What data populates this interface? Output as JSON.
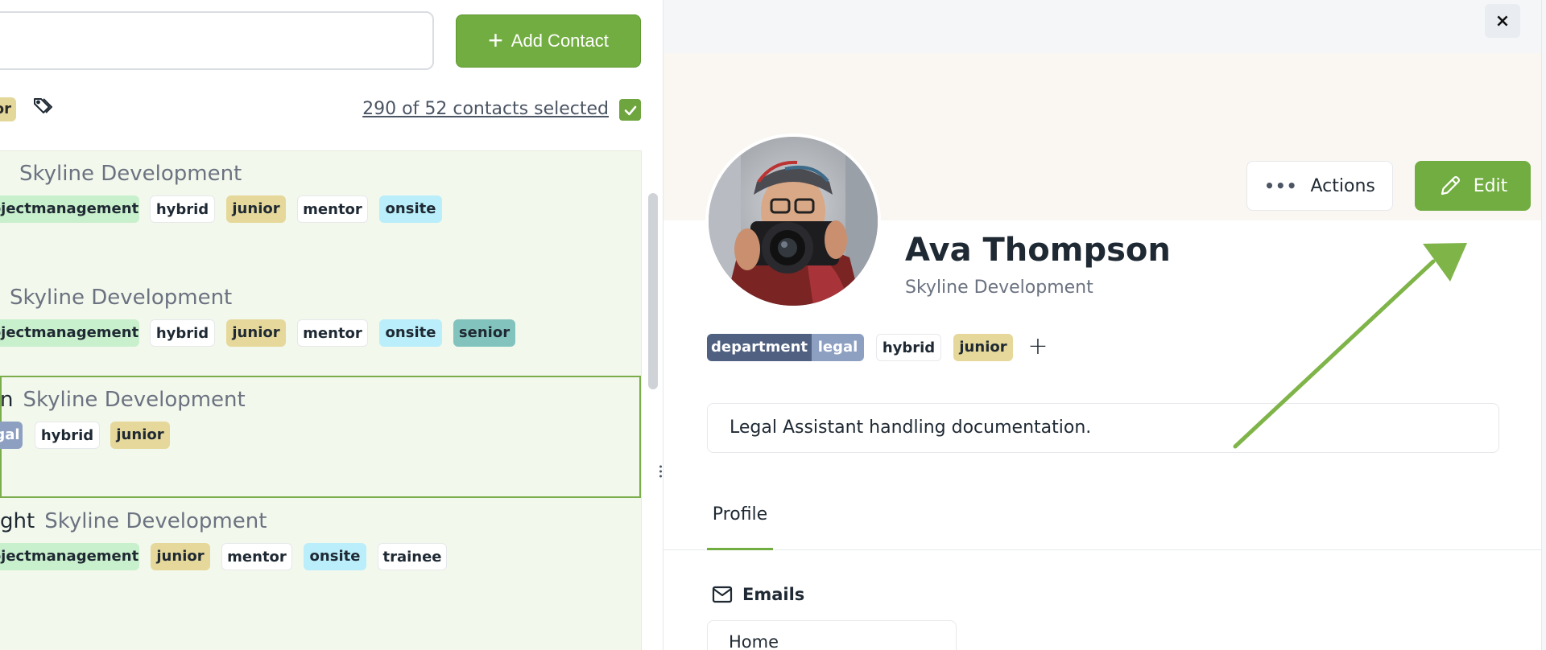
{
  "search": {
    "value": "",
    "placeholder": ""
  },
  "toolbar": {
    "add_contact_label": "Add Contact",
    "filter_chip": "or",
    "selection_text": "290 of 52 contacts selected",
    "select_all_checked": true
  },
  "contacts": [
    {
      "name": "",
      "company": "Skyline Development",
      "tags": [
        "ojectmanagement",
        "hybrid",
        "junior",
        "mentor",
        "onsite"
      ]
    },
    {
      "name": "",
      "company": "Skyline Development",
      "tags": [
        "ojectmanagement",
        "hybrid",
        "junior",
        "mentor",
        "onsite",
        "senior"
      ]
    },
    {
      "name": "n",
      "company": "Skyline Development",
      "tags": [
        "gal",
        "hybrid",
        "junior"
      ]
    },
    {
      "name": "ght",
      "company": "Skyline Development",
      "tags": [
        "ojectmanagement",
        "junior",
        "mentor",
        "onsite",
        "trainee"
      ]
    }
  ],
  "detail": {
    "close_label": "×",
    "actions_label": "Actions",
    "edit_label": "Edit",
    "name": "Ava Thompson",
    "company": "Skyline Development",
    "tags": {
      "department_key": "department",
      "department_value": "legal",
      "hybrid": "hybrid",
      "junior": "junior",
      "add": "+"
    },
    "description": "Legal Assistant handling documentation.",
    "tabs": [
      {
        "label": "Profile",
        "active": true
      }
    ],
    "emails_heading": "Emails",
    "email_card_label": "Home"
  },
  "colors": {
    "accent_green": "#72ad41",
    "selected_row_border": "#7cad4d",
    "annotation_arrow": "#7fb449"
  }
}
